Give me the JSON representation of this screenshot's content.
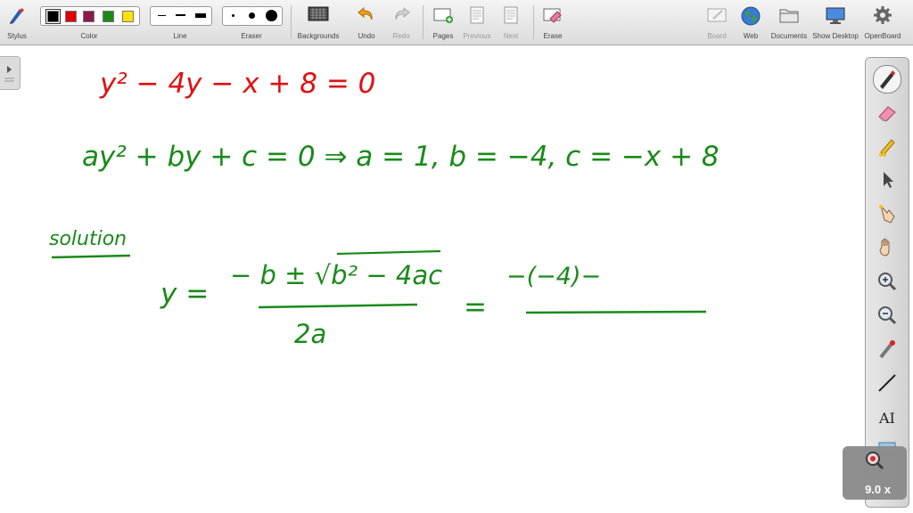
{
  "toolbar": {
    "stylus": "Stylus",
    "color": "Color",
    "line": "Line",
    "eraser": "Eraser",
    "backgrounds": "Backgrounds",
    "undo": "Undo",
    "redo": "Redo",
    "pages": "Pages",
    "previous": "Previous",
    "next": "Next",
    "erase": "Erase",
    "board": "Board",
    "web": "Web",
    "documents": "Documents",
    "show_desktop": "Show Desktop",
    "openboard": "OpenBoard"
  },
  "colors": {
    "swatches": [
      "#000000",
      "#e00000",
      "#8b1a4a",
      "#1a8a1a",
      "#ffe000"
    ],
    "ink_red": "#e01010",
    "ink_green": "#1a8a1a"
  },
  "board": {
    "line1": "y² − 4y − x + 8 = 0",
    "line2": "ay² + by + c = 0  ⇒  a = 1,  b = −4,  c = −x + 8",
    "heading": "solution",
    "formula_lhs": "y =",
    "numerator": "− b ± √b² − 4ac",
    "denominator": "2a",
    "equals": "=",
    "step_numerator": "−(−4)−"
  },
  "zoom": "9.0 x"
}
